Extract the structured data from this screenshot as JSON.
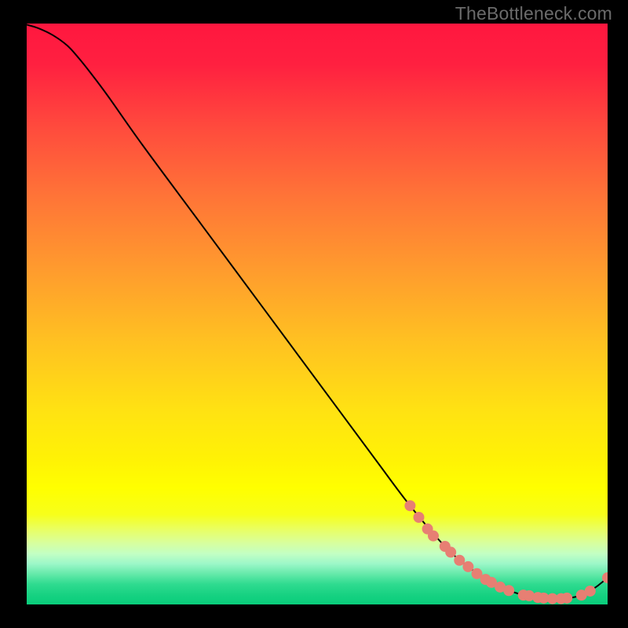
{
  "watermark": "TheBottleneck.com",
  "chart_data": {
    "type": "line",
    "title": "",
    "xlabel": "",
    "ylabel": "",
    "xlim": [
      0,
      100
    ],
    "ylim": [
      0,
      100
    ],
    "grid": false,
    "legend": false,
    "background_gradient": {
      "stops": [
        {
          "pos": 0.0,
          "color": "#ff173f"
        },
        {
          "pos": 0.07,
          "color": "#ff2040"
        },
        {
          "pos": 0.18,
          "color": "#ff4b3d"
        },
        {
          "pos": 0.3,
          "color": "#ff7537"
        },
        {
          "pos": 0.42,
          "color": "#ff9a2e"
        },
        {
          "pos": 0.55,
          "color": "#ffc221"
        },
        {
          "pos": 0.67,
          "color": "#ffe312"
        },
        {
          "pos": 0.75,
          "color": "#fff205"
        },
        {
          "pos": 0.8,
          "color": "#ffff00"
        },
        {
          "pos": 0.845,
          "color": "#f7ff1a"
        },
        {
          "pos": 0.872,
          "color": "#e8ff66"
        },
        {
          "pos": 0.895,
          "color": "#d7ffa0"
        },
        {
          "pos": 0.913,
          "color": "#c2ffc4"
        },
        {
          "pos": 0.93,
          "color": "#9cf7c8"
        },
        {
          "pos": 0.948,
          "color": "#63e9a9"
        },
        {
          "pos": 0.965,
          "color": "#2fdb90"
        },
        {
          "pos": 0.985,
          "color": "#15d181"
        },
        {
          "pos": 1.0,
          "color": "#0acd7b"
        }
      ]
    },
    "series": [
      {
        "name": "bottleneck-curve",
        "stroke": "#000000",
        "x": [
          0.0,
          2.0,
          4.5,
          7.0,
          9.0,
          11.0,
          14.0,
          20.0,
          30.0,
          40.0,
          50.0,
          60.0,
          66.0,
          72.0,
          76.0,
          80.0,
          83.0,
          86.0,
          89.0,
          92.0,
          94.0,
          96.0,
          98.0,
          100.0
        ],
        "y": [
          99.8,
          99.2,
          98.0,
          96.2,
          94.0,
          91.5,
          87.5,
          79.0,
          65.5,
          52.0,
          38.5,
          25.0,
          17.0,
          10.0,
          6.5,
          3.8,
          2.4,
          1.5,
          1.1,
          1.0,
          1.2,
          1.8,
          3.0,
          4.6
        ]
      }
    ],
    "markers": {
      "name": "highlighted-points",
      "color": "#e77f73",
      "radius_px": 7,
      "points": [
        {
          "x": 66.0,
          "y": 17.0
        },
        {
          "x": 67.5,
          "y": 15.0
        },
        {
          "x": 69.0,
          "y": 13.0
        },
        {
          "x": 70.0,
          "y": 11.8
        },
        {
          "x": 72.0,
          "y": 10.0
        },
        {
          "x": 73.0,
          "y": 9.0
        },
        {
          "x": 74.5,
          "y": 7.6
        },
        {
          "x": 76.0,
          "y": 6.5
        },
        {
          "x": 77.5,
          "y": 5.3
        },
        {
          "x": 79.0,
          "y": 4.3
        },
        {
          "x": 80.0,
          "y": 3.8
        },
        {
          "x": 81.5,
          "y": 3.0
        },
        {
          "x": 83.0,
          "y": 2.4
        },
        {
          "x": 85.5,
          "y": 1.6
        },
        {
          "x": 86.5,
          "y": 1.5
        },
        {
          "x": 88.0,
          "y": 1.2
        },
        {
          "x": 89.0,
          "y": 1.1
        },
        {
          "x": 90.5,
          "y": 1.0
        },
        {
          "x": 92.0,
          "y": 1.0
        },
        {
          "x": 93.0,
          "y": 1.1
        },
        {
          "x": 95.5,
          "y": 1.6
        },
        {
          "x": 97.0,
          "y": 2.3
        },
        {
          "x": 100.0,
          "y": 4.6
        }
      ]
    }
  }
}
